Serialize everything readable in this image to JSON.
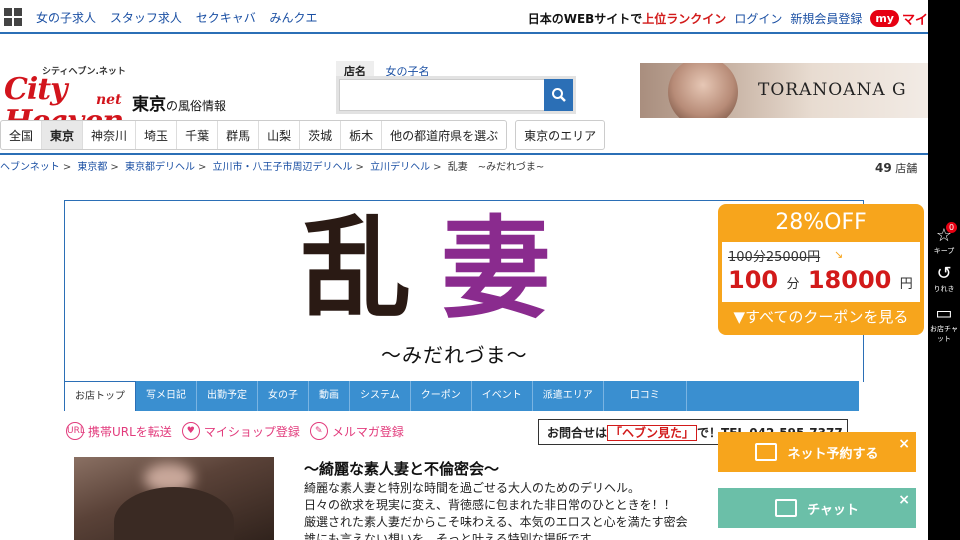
{
  "topbar": {
    "links": [
      "女の子求人",
      "スタッフ求人",
      "セクキャバ",
      "みんクエ"
    ],
    "rank_prefix": "日本のWEBサイトで",
    "rank_highlight": "上位ランクイン",
    "login": "ログイン",
    "register": "新規会員登録",
    "my_badge": "my",
    "my_text": "マイ"
  },
  "logo": {
    "small": "シティヘブン.ネット",
    "big": "City Heaven",
    "net": "net"
  },
  "region": {
    "name": "東京",
    "suffix": "の風俗情報"
  },
  "search": {
    "tab_shop": "店名",
    "tab_girl": "女の子名",
    "placeholder": ""
  },
  "ad": {
    "text": "TORANOANA G"
  },
  "prefectures": [
    "全国",
    "東京",
    "神奈川",
    "埼玉",
    "千葉",
    "群馬",
    "山梨",
    "茨城",
    "栃木",
    "他の都道府県を選ぶ"
  ],
  "area_button": "東京のエリア",
  "breadcrumb": [
    "ヘブンネット",
    "東京都",
    "東京都デリヘル",
    "立川市・八王子市周辺デリヘル",
    "立川デリヘル"
  ],
  "breadcrumb_current": "乱妻　~みだれづま~",
  "shop_count": {
    "num": "49",
    "unit": "店舗"
  },
  "shop": {
    "logo_k1": "乱",
    "logo_k2": "妻",
    "logo_sub": "～みだれづま～"
  },
  "shop_tabs": [
    "お店トップ",
    "写メ日記",
    "出勤予定",
    "女の子",
    "動画",
    "システム",
    "クーポン",
    "イベント",
    "派遣エリア",
    "口コミ"
  ],
  "actions": {
    "url": "携帯URLを転送",
    "myshop": "マイショップ登録",
    "mail": "メルマガ登録",
    "url_icon": "URL"
  },
  "contact": {
    "prefix": "お問合せは",
    "highlight": "「ヘブン見た」",
    "suffix": "で！TEL 042-595-7377"
  },
  "content": {
    "title": "～綺麗な素人妻と不倫密会～",
    "lines": [
      "綺麗な素人妻と特別な時間を過ごせる大人のためのデリヘル。",
      "日々の欲求を現実に変え、背徳感に包まれた非日常のひとときを！！",
      "厳選された素人妻だからこそ味わえる、本気のエロスと心を満たす密会",
      "誰にも言えない想いを、そっと叶える特別な場所です。"
    ]
  },
  "coupon": {
    "pct": "28%OFF",
    "orig": "100分25000円",
    "new_min": "100",
    "new_unit": "分",
    "new_price": "18000",
    "new_yen": "円",
    "see_all": "▼すべてのクーポンを見る"
  },
  "float": {
    "reserve": "ネット予約する",
    "chat": "チャット",
    "close": "×"
  },
  "sidebar": {
    "keep_label": "キープ",
    "keep_badge": "0",
    "history_label": "りれき",
    "chat_label": "お店チャット"
  },
  "colors": {
    "brand_blue": "#2b6fb6",
    "accent_red": "#d21a1a",
    "coupon_orange": "#f7a51c",
    "chat_green": "#6bbfa8"
  }
}
